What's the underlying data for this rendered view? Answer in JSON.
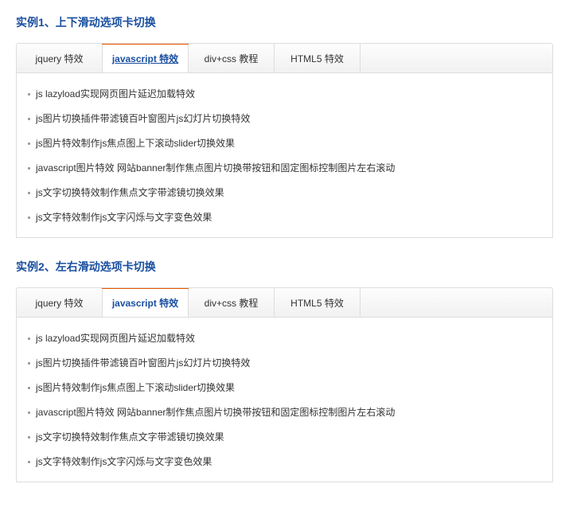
{
  "examples": [
    {
      "title": "实例1、上下滑动选项卡切换",
      "tabs": [
        {
          "label": "jquery 特效",
          "active": false
        },
        {
          "label": "javascript 特效",
          "active": true,
          "underline": true
        },
        {
          "label": "div+css 教程",
          "active": false
        },
        {
          "label": "HTML5 特效",
          "active": false
        }
      ],
      "items": [
        "js lazyload实现网页图片延迟加载特效",
        "js图片切换插件带滤镜百叶窗图片js幻灯片切换特效",
        "js图片特效制作js焦点图上下滚动slider切换效果",
        "javascript图片特效 网站banner制作焦点图片切换带按钮和固定图标控制图片左右滚动",
        "js文字切换特效制作焦点文字带滤镜切换效果",
        "js文字特效制作js文字闪烁与文字变色效果"
      ]
    },
    {
      "title": "实例2、左右滑动选项卡切换",
      "tabs": [
        {
          "label": "jquery 特效",
          "active": false
        },
        {
          "label": "javascript 特效",
          "active": true
        },
        {
          "label": "div+css 教程",
          "active": false
        },
        {
          "label": "HTML5 特效",
          "active": false
        }
      ],
      "items": [
        "js lazyload实现网页图片延迟加载特效",
        "js图片切换插件带滤镜百叶窗图片js幻灯片切换特效",
        "js图片特效制作js焦点图上下滚动slider切换效果",
        "javascript图片特效 网站banner制作焦点图片切换带按钮和固定图标控制图片左右滚动",
        "js文字切换特效制作焦点文字带滤镜切换效果",
        "js文字特效制作js文字闪烁与文字变色效果"
      ]
    }
  ]
}
